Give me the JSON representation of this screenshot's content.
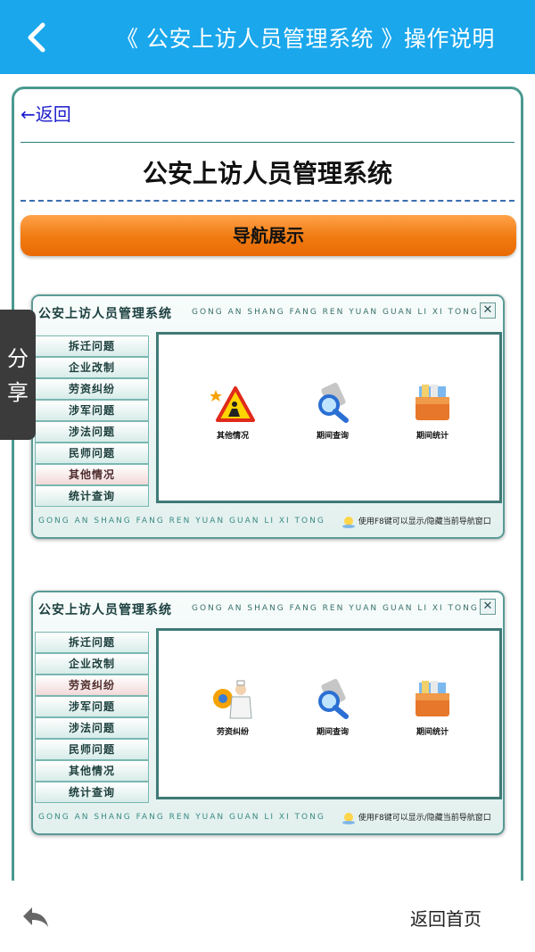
{
  "header": {
    "title": "《 公安上访人员管理系统 》操作说明",
    "bg_color": "#1aa7ec"
  },
  "back_link": "←返回",
  "main_title": "公安上访人员管理系统",
  "section_button": "导航展示",
  "share": {
    "label1": "分",
    "label2": "享"
  },
  "windows": [
    {
      "title": "公安上访人员管理系统",
      "pinyin": "GONG AN SHANG FANG REN YUAN GUAN LI XI TONG",
      "close": "✕",
      "menu": [
        "拆迁问题",
        "企业改制",
        "劳资纠纷",
        "涉军问题",
        "涉法问题",
        "民师问题",
        "其他情况",
        "统计查询"
      ],
      "active_index": 6,
      "icons": [
        {
          "name": "other-situation-icon",
          "label": "其他情况"
        },
        {
          "name": "period-query-icon",
          "label": "期间查询"
        },
        {
          "name": "period-stats-icon",
          "label": "期间统计"
        }
      ],
      "footer": "GONG AN SHANG FANG REN YUAN GUAN LI XI TONG",
      "tip": "使用F8键可以显示/隐藏当前导航窗口"
    },
    {
      "title": "公安上访人员管理系统",
      "pinyin": "GONG AN SHANG FANG REN YUAN GUAN LI XI TONG",
      "close": "✕",
      "menu": [
        "拆迁问题",
        "企业改制",
        "劳资纠纷",
        "涉军问题",
        "涉法问题",
        "民师问题",
        "其他情况",
        "统计查询"
      ],
      "active_index": 2,
      "icons": [
        {
          "name": "labor-dispute-icon",
          "label": "劳资纠纷"
        },
        {
          "name": "period-query-icon",
          "label": "期间查询"
        },
        {
          "name": "period-stats-icon",
          "label": "期间统计"
        }
      ],
      "footer": "GONG AN SHANG FANG REN YUAN GUAN LI XI TONG",
      "tip": "使用F8键可以显示/隐藏当前导航窗口"
    }
  ],
  "bottom": {
    "home": "返回首页"
  }
}
